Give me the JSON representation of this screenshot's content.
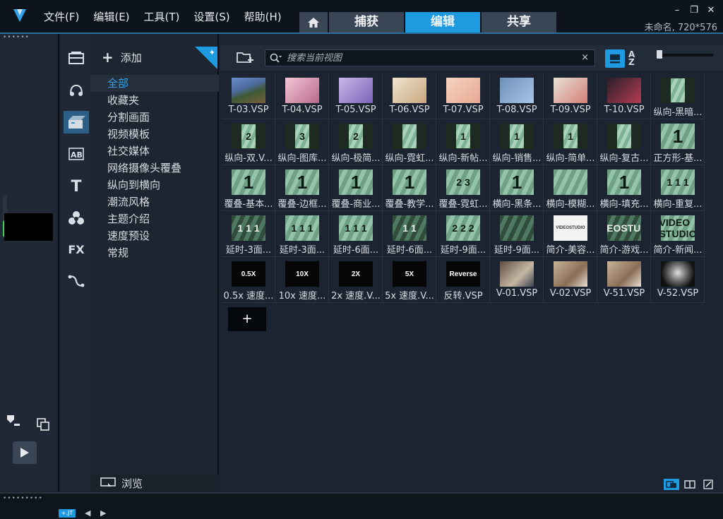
{
  "menus": [
    {
      "label": "文件(F)"
    },
    {
      "label": "编辑(E)"
    },
    {
      "label": "工具(T)"
    },
    {
      "label": "设置(S)"
    },
    {
      "label": "帮助(H)"
    }
  ],
  "mode_tabs": {
    "capture": "捕获",
    "edit": "编辑",
    "share": "共享",
    "active": "edit"
  },
  "project_info": "未命名, 720*576",
  "accent_color": "#1e9be0",
  "library": {
    "add_label": "添加",
    "browse_label": "浏览",
    "categories": [
      {
        "label": "全部",
        "selected": true
      },
      {
        "label": "收藏夹"
      },
      {
        "label": "分割画面"
      },
      {
        "label": "视频模板"
      },
      {
        "label": "社交媒体"
      },
      {
        "label": "网络摄像头覆叠"
      },
      {
        "label": "纵向到横向"
      },
      {
        "label": "潮流风格"
      },
      {
        "label": "主题介绍"
      },
      {
        "label": "速度预设"
      },
      {
        "label": "常规"
      }
    ],
    "search_placeholder": "搜索当前视图",
    "add_tile_label": "+",
    "items": [
      {
        "label": "T-03.VSP",
        "thumb": "scene",
        "text": ""
      },
      {
        "label": "T-04.VSP",
        "thumb": "pink",
        "text": ""
      },
      {
        "label": "T-05.VSP",
        "thumb": "lav",
        "text": ""
      },
      {
        "label": "T-06.VSP",
        "thumb": "cream",
        "text": ""
      },
      {
        "label": "T-07.VSP",
        "thumb": "peach",
        "text": ""
      },
      {
        "label": "T-08.VSP",
        "thumb": "blue",
        "text": ""
      },
      {
        "label": "T-09.VSP",
        "thumb": "couple",
        "text": ""
      },
      {
        "label": "T-10.VSP",
        "thumb": "dark",
        "text": ""
      },
      {
        "label": "纵向-黑暗...",
        "thumb": "vert",
        "text": ""
      },
      {
        "label": "纵向-双.V...",
        "thumb": "vert",
        "text": "2"
      },
      {
        "label": "纵向-图库...",
        "thumb": "vert",
        "text": "3"
      },
      {
        "label": "纵向-极简...",
        "thumb": "vert",
        "text": "2"
      },
      {
        "label": "纵向-霓虹...",
        "thumb": "vert",
        "text": ""
      },
      {
        "label": "纵向-新帖...",
        "thumb": "vert",
        "text": "1"
      },
      {
        "label": "纵向-销售...",
        "thumb": "vert",
        "text": "1"
      },
      {
        "label": "纵向-简单...",
        "thumb": "vert",
        "text": "1"
      },
      {
        "label": "纵向-复古...",
        "thumb": "vert",
        "text": ""
      },
      {
        "label": "正方形-基...",
        "thumb": "stripe",
        "text": "1"
      },
      {
        "label": "覆叠-基本...",
        "thumb": "stripe",
        "text": "1"
      },
      {
        "label": "覆叠-边框...",
        "thumb": "stripe",
        "text": "1"
      },
      {
        "label": "覆叠-商业...",
        "thumb": "stripe",
        "text": "1"
      },
      {
        "label": "覆叠-教学...",
        "thumb": "stripe",
        "text": "1"
      },
      {
        "label": "覆叠-霓虹...",
        "thumb": "stripe",
        "text": "2 3"
      },
      {
        "label": "横向-黑条...",
        "thumb": "stripe",
        "text": "1"
      },
      {
        "label": "横向-模糊...",
        "thumb": "stripe",
        "text": ""
      },
      {
        "label": "横向-填充...",
        "thumb": "stripe",
        "text": "1"
      },
      {
        "label": "横向-重复...",
        "thumb": "stripe",
        "text": "1 1 1"
      },
      {
        "label": "延时-3面...",
        "thumb": "striped-dark",
        "text": "1 1 1"
      },
      {
        "label": "延时-3面...",
        "thumb": "stripe",
        "text": "1 1 1"
      },
      {
        "label": "延时-6面...",
        "thumb": "stripe",
        "text": "1 1 1"
      },
      {
        "label": "延时-6面...",
        "thumb": "striped-dark",
        "text": "1 1"
      },
      {
        "label": "延时-9面...",
        "thumb": "stripe",
        "text": "2 2 2"
      },
      {
        "label": "延时-9面...",
        "thumb": "striped-dark",
        "text": ""
      },
      {
        "label": "简介-美容...",
        "thumb": "white",
        "text": "VIDEOSTUDIO"
      },
      {
        "label": "简介-游戏...",
        "thumb": "striped-dark",
        "text": "VIDEOSTUDIO"
      },
      {
        "label": "简介-新闻...",
        "thumb": "stripe",
        "text": "VIDEO STUDIO"
      },
      {
        "label": "0.5x 速度...",
        "thumb": "black",
        "text": "0.5X"
      },
      {
        "label": "10x 速度...",
        "thumb": "black",
        "text": "10X"
      },
      {
        "label": "2x 速度.V...",
        "thumb": "black",
        "text": "2X"
      },
      {
        "label": "5x 速度.V...",
        "thumb": "black",
        "text": "5X"
      },
      {
        "label": "反转.VSP",
        "thumb": "black",
        "text": "Reverse"
      },
      {
        "label": "V-01.VSP",
        "thumb": "photo",
        "text": ""
      },
      {
        "label": "V-02.VSP",
        "thumb": "photo2",
        "text": ""
      },
      {
        "label": "V-51.VSP",
        "thumb": "photo2",
        "text": ""
      },
      {
        "label": "V-52.VSP",
        "thumb": "bw",
        "text": ""
      }
    ]
  },
  "volume_level": 0.4,
  "timeline": {
    "track_button": "+.JT"
  }
}
